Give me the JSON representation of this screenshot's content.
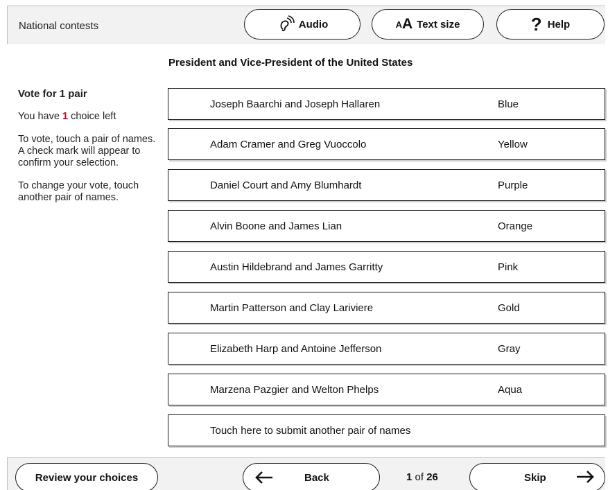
{
  "header": {
    "section_title": "National contests",
    "audio_label": "Audio",
    "text_size_small": "A",
    "text_size_big": "A",
    "text_size_label": "Text size",
    "help_glyph": "?",
    "help_label": "Help"
  },
  "contest": {
    "title": "President and Vice-President of the United States"
  },
  "sidebar": {
    "vote_for": "Vote for 1 pair",
    "choices_prefix": "You have ",
    "choices_count": "1",
    "choices_suffix": " choice left",
    "instructions": "To vote, touch a pair of names. A check mark will appear to confirm your selection.",
    "change_instructions": "To change your vote, touch another pair of names."
  },
  "candidates": [
    {
      "names": "Joseph Baarchi and Joseph Hallaren",
      "party": "Blue"
    },
    {
      "names": "Adam Cramer and Greg Vuoccolo",
      "party": "Yellow"
    },
    {
      "names": "Daniel Court and Amy Blumhardt",
      "party": "Purple"
    },
    {
      "names": "Alvin Boone and James Lian",
      "party": "Orange"
    },
    {
      "names": "Austin Hildebrand and James Garritty",
      "party": "Pink"
    },
    {
      "names": "Martin Patterson and Clay Lariviere",
      "party": "Gold"
    },
    {
      "names": "Elizabeth Harp and Antoine Jefferson",
      "party": "Gray"
    },
    {
      "names": "Marzena Pazgier and Welton Phelps",
      "party": "Aqua"
    }
  ],
  "write_in": {
    "label": "Touch here to submit another pair of names"
  },
  "footer": {
    "review_label": "Review your choices",
    "back_label": "Back",
    "page_current": "1",
    "page_of": " of ",
    "page_total": "26",
    "skip_label": "Skip"
  },
  "icons": {
    "audio": "ear-with-sound-waves-icon",
    "back": "arrow-left-icon",
    "skip": "arrow-right-icon"
  }
}
